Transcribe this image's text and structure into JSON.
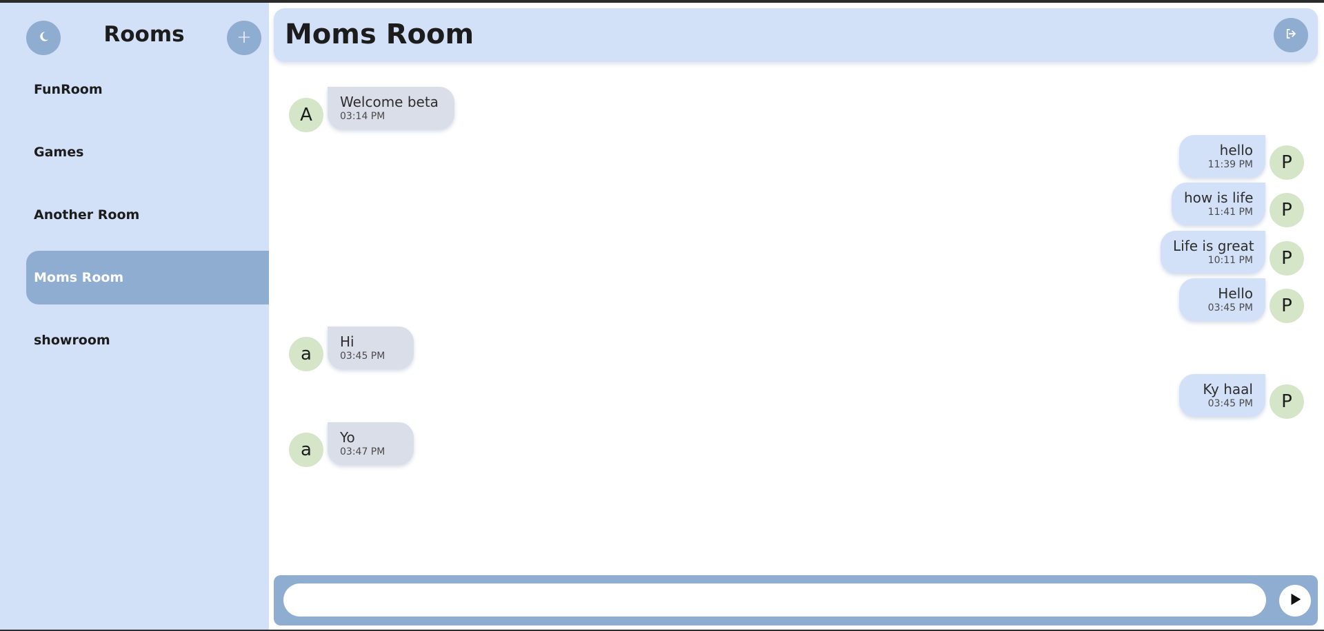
{
  "sidebar": {
    "title": "Rooms",
    "theme_icon": "moon-icon",
    "add_label": "+",
    "rooms": [
      {
        "label": "FunRoom",
        "active": false
      },
      {
        "label": "Games",
        "active": false
      },
      {
        "label": "Another Room",
        "active": false
      },
      {
        "label": "Moms Room",
        "active": true
      },
      {
        "label": "showroom",
        "active": false
      }
    ]
  },
  "chat": {
    "title": "Moms Room",
    "logout_icon": "logout-icon",
    "messages": [
      {
        "side": "left",
        "avatar": "A",
        "text": "Welcome beta",
        "time": "03:14 PM"
      },
      {
        "side": "right",
        "avatar": "P",
        "text": "hello",
        "time": "11:39 PM"
      },
      {
        "side": "right",
        "avatar": "P",
        "text": "how is life",
        "time": "11:41 PM"
      },
      {
        "side": "right",
        "avatar": "P",
        "text": "Life is great",
        "time": "10:11 PM"
      },
      {
        "side": "right",
        "avatar": "P",
        "text": "Hello",
        "time": "03:45 PM"
      },
      {
        "side": "left",
        "avatar": "a",
        "text": "Hi",
        "time": "03:45 PM"
      },
      {
        "side": "right",
        "avatar": "P",
        "text": "Ky haal",
        "time": "03:45 PM"
      },
      {
        "side": "left",
        "avatar": "a",
        "text": "Yo",
        "time": "03:47 PM"
      }
    ]
  },
  "composer": {
    "placeholder": "",
    "value": "",
    "send_icon": "send-icon"
  },
  "colors": {
    "sidebar_bg": "#d2e0f8",
    "accent": "#8facd1",
    "avatar_bg": "#d5e6c8",
    "bubble_left": "#d9dee8",
    "bubble_right": "#d2e0f8"
  }
}
